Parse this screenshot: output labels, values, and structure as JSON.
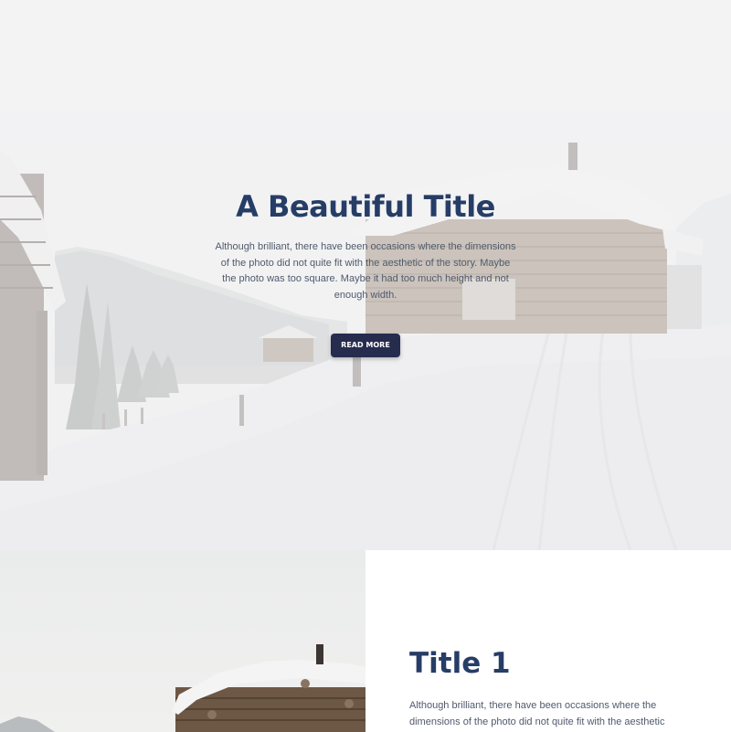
{
  "hero": {
    "title": "A Beautiful Title",
    "body": "Although brilliant, there have been occasions where the dimensions of the photo did not quite fit with the aesthetic of the story. Maybe the photo was too square. Maybe it had too much height and not enough width.",
    "button_label": "READ MORE"
  },
  "section1": {
    "title": "Title 1",
    "body": "Although brilliant, there have been occasions where the dimensions of the photo did not quite fit with the aesthetic"
  },
  "colors": {
    "title": "#263d66",
    "button": "#262c4e",
    "body_text": "#505a6c"
  }
}
